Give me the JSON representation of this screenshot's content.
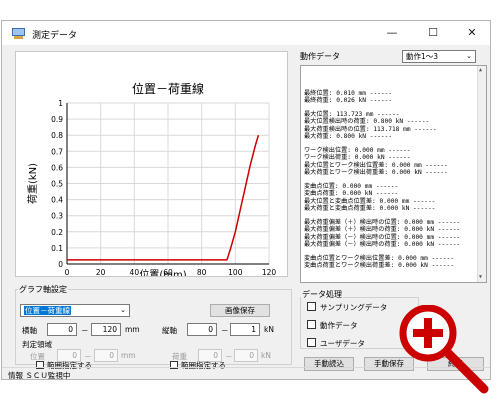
{
  "window": {
    "title": "測定データ"
  },
  "chart_data": {
    "type": "line",
    "title": "位置－荷重線",
    "xlabel": "位置(mm)",
    "ylabel": "荷重(kN)",
    "xlim": [
      0,
      120
    ],
    "ylim": [
      0,
      1
    ],
    "xticks": [
      "0",
      "20",
      "40",
      "60",
      "80",
      "100",
      "120"
    ],
    "yticks": [
      "0",
      "0.1",
      "0.2",
      "0.3",
      "0.4",
      "0.5",
      "0.6",
      "0.7",
      "0.8",
      "0.9",
      "1"
    ],
    "series": [
      {
        "x": [
          0,
          95,
          97,
          100,
          103,
          106,
          109,
          112,
          113.7
        ],
        "y": [
          0.026,
          0.026,
          0.09,
          0.2,
          0.34,
          0.48,
          0.62,
          0.74,
          0.8
        ],
        "color": "#cc0000"
      }
    ]
  },
  "right_panel": {
    "header": "動作データ",
    "select": "動作1～3",
    "lines": [
      "最終位置: 0.010 mm ------",
      "最終荷重: 0.026 kN ------",
      "",
      "最大位置: 113.723 mm ------",
      "最大位置検出時の荷重: 0.800 kN ------",
      "最大荷重検出時の位置: 113.718 mm ------",
      "最大荷重: 0.800 kN ------",
      "",
      "ワーク検出位置: 0.000 mm ------",
      "ワーク検出荷重: 0.000 kN ------",
      "最大位置とワーク検出位置差: 0.000 mm ------",
      "最大荷重とワーク検出荷重差: 0.000 kN ------",
      "",
      "変曲点位置: 0.000 mm ------",
      "変曲点荷重: 0.000 kN ------",
      "最大位置と変曲点位置差: 0.000 mm ------",
      "最大荷重と変曲点荷重差: 0.000 kN ------",
      "",
      "最大荷重偏差（＋）検出時の位置: 0.000 mm ------",
      "最大荷重偏差（＋）検出時の荷重: 0.000 kN ------",
      "最大荷重偏差（－）検出時の位置: 0.000 mm ------",
      "最大荷重偏差（－）検出時の荷重: 0.000 kN ------",
      "",
      "変曲点位置とワーク検出位置差: 0.000 mm ------",
      "変曲点荷重とワーク検出荷重差: 0.000 kN ------"
    ]
  },
  "graph_settings": {
    "label": "グラフ軸設定",
    "combo": "位置－荷重線",
    "save_image": "画像保存",
    "x_axis": {
      "label": "横軸",
      "min": "0",
      "dash": "－",
      "max": "120",
      "unit": "mm"
    },
    "y_axis": {
      "label": "縦軸",
      "min": "0",
      "dash": "－",
      "max": "1",
      "unit": "kN"
    },
    "judge": {
      "label": "判定領域",
      "pos_label": "位置",
      "pos_min": "0",
      "dash": "－",
      "pos_max": "0",
      "pos_unit": "mm",
      "load_label": "荷重",
      "load_min": "0",
      "load_max": "0",
      "load_unit": "kN"
    },
    "range_check": "範囲指定する"
  },
  "data_processing": {
    "label": "データ処理",
    "sampling": "サンプリングデータ",
    "motion": "動作データ",
    "user": "ユーザデータ",
    "manual_load": "手動読込",
    "manual_save": "手動保存",
    "partial": "終了"
  },
  "status": {
    "text": "情報 ＳＣＵ監視中"
  }
}
